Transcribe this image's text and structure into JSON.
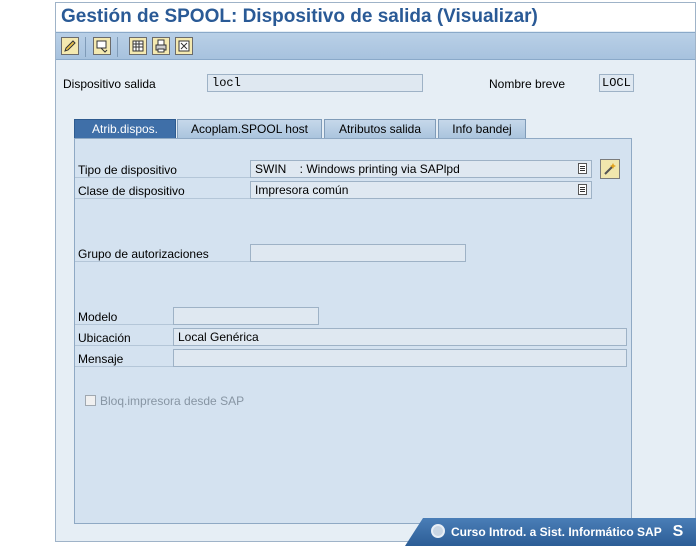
{
  "window": {
    "title": "Gestión de SPOOL: Dispositivo de salida (Visualizar)"
  },
  "toolbar": {
    "buttons": [
      "pencil-icon",
      "display-change-icon",
      "grid-icon",
      "printer-icon",
      "settings-icon"
    ]
  },
  "header": {
    "device_label": "Dispositivo salida",
    "device_value": "locl",
    "short_name_label": "Nombre breve",
    "short_name_value": "LOCL"
  },
  "tabs": [
    {
      "label": "Atrib.dispos.",
      "active": true
    },
    {
      "label": "Acoplam.SPOOL host",
      "active": false
    },
    {
      "label": "Atributos salida",
      "active": false
    },
    {
      "label": "Info bandej",
      "active": false
    }
  ],
  "form": {
    "device_type_label": "Tipo de dispositivo",
    "device_type_value": "SWIN    : Windows printing via SAPlpd",
    "device_class_label": "Clase de dispositivo",
    "device_class_value": "Impresora común",
    "auth_group_label": "Grupo de autorizaciones",
    "auth_group_value": "",
    "model_label": "Modelo",
    "model_value": "",
    "location_label": "Ubicación",
    "location_value": "Local Genérica",
    "message_label": "Mensaje",
    "message_value": "",
    "lock_label": "Bloq.impresora desde SAP",
    "lock_checked": false
  },
  "footer": {
    "text": "Curso Introd. a Sist. Informático SAP",
    "logo": "S"
  },
  "colors": {
    "title": "#2a5a96",
    "toolbar": "#a7c2de",
    "active_tab": "#3f6fa8",
    "panel": "#d4e2f0"
  }
}
